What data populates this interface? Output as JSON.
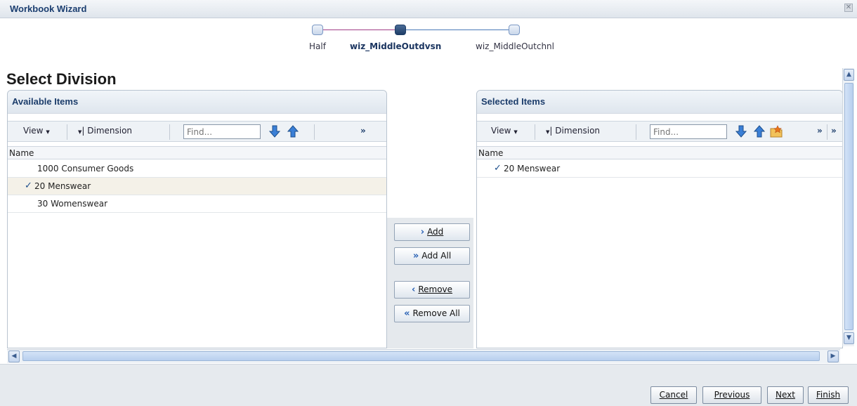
{
  "window": {
    "title": "Workbook Wizard",
    "close_glyph": "✕"
  },
  "train": {
    "steps": [
      {
        "label": "Half",
        "current": false
      },
      {
        "label": "wiz_MiddleOutdvsn",
        "current": true
      },
      {
        "label": "wiz_MiddleOutchnl",
        "current": false
      }
    ]
  },
  "page": {
    "heading": "Select Division"
  },
  "available": {
    "title": "Available Items",
    "view_label": "View",
    "dimension_label": "Dimension",
    "find_placeholder": "Find...",
    "more_glyph": "»",
    "column_header": "Name",
    "rows": [
      {
        "label": "1000 Consumer Goods",
        "checked": false
      },
      {
        "label": "20 Menswear",
        "checked": true
      },
      {
        "label": "30 Womenswear",
        "checked": false
      }
    ]
  },
  "selected": {
    "title": "Selected Items",
    "view_label": "View",
    "dimension_label": "Dimension",
    "find_placeholder": "Find...",
    "more_glyph": "»",
    "more_glyph2": "»",
    "column_header": "Name",
    "rows": [
      {
        "label": "20 Menswear",
        "checked": true
      }
    ]
  },
  "shuttle": {
    "add": "Add",
    "add_all": "Add All",
    "remove": "Remove",
    "remove_all": "Remove All"
  },
  "footer": {
    "cancel": "Cancel",
    "previous": "Previous",
    "next": "Next",
    "finish": "Finish"
  },
  "glyphs": {
    "check": "✓",
    "dropdown": "▼"
  },
  "colors": {
    "accent": "#1b3e70",
    "train_past": "#a03e86",
    "train_future": "#4a79b8"
  }
}
